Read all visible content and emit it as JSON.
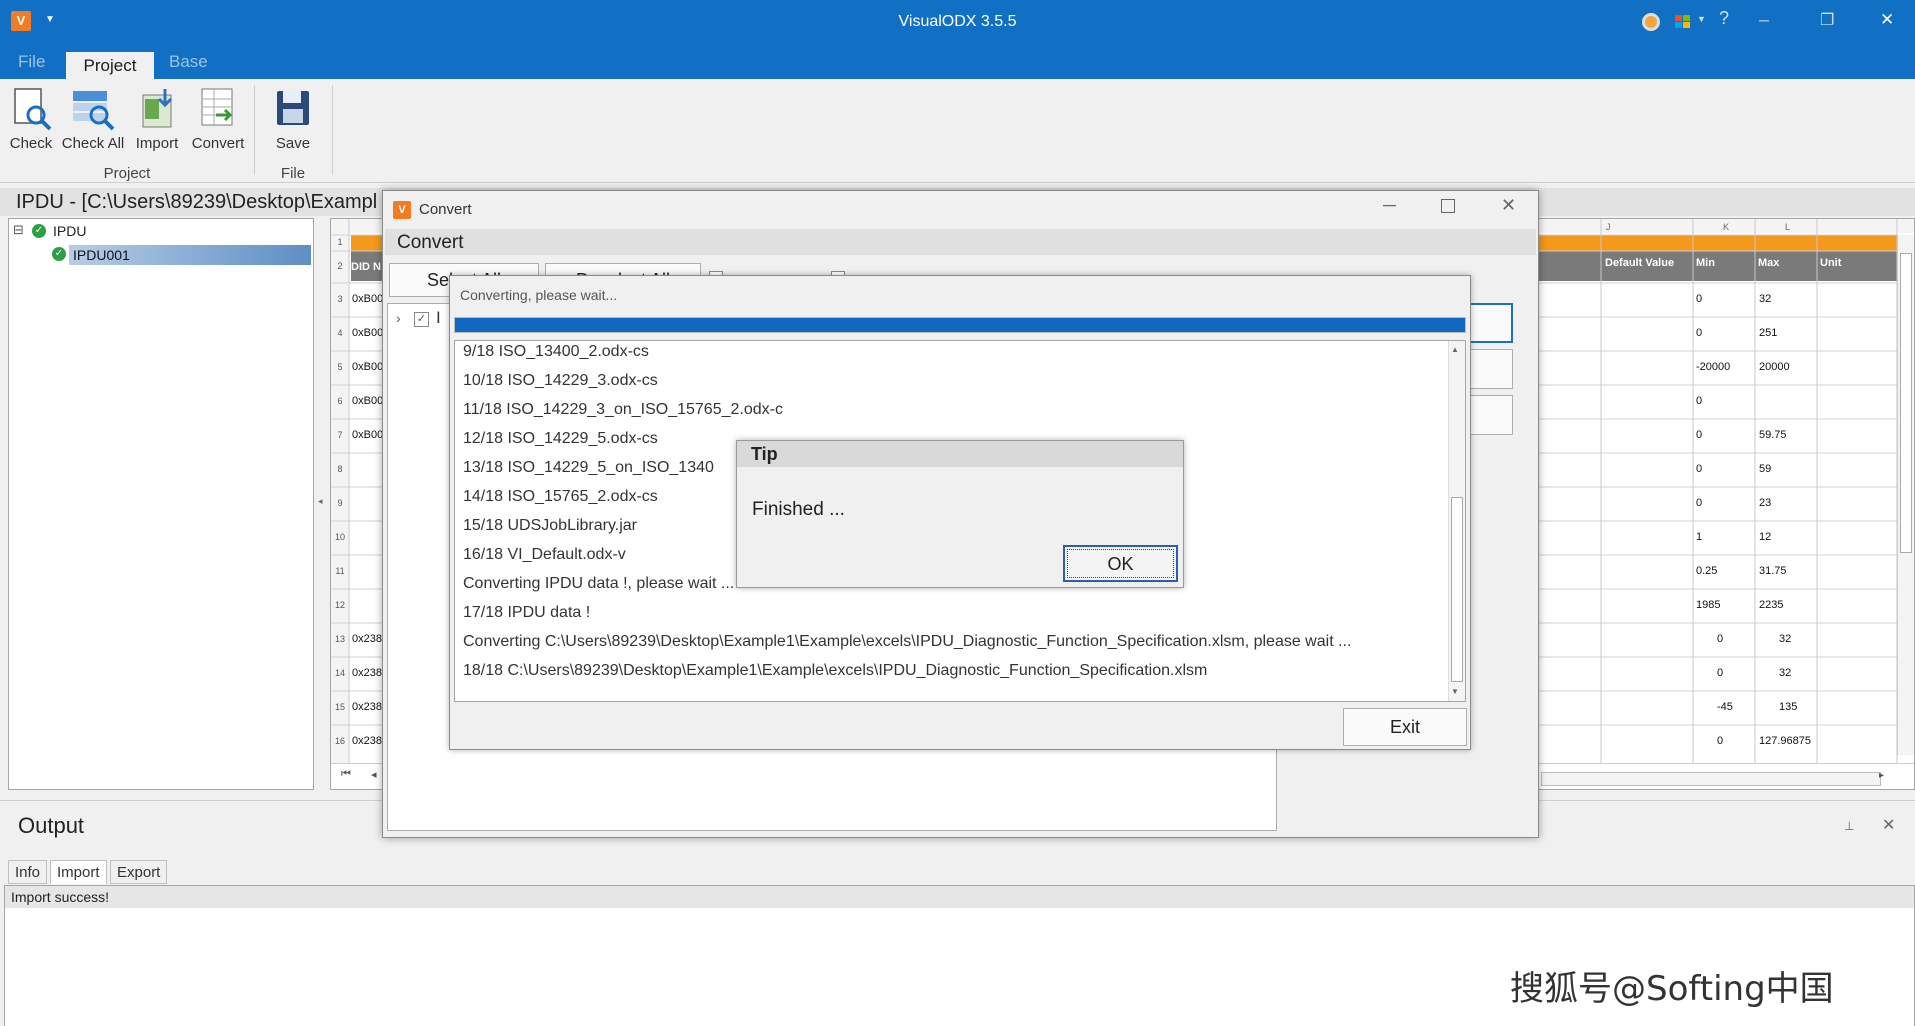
{
  "window": {
    "title": "VisualODX 3.5.5",
    "logo_text": "V",
    "controls": {
      "help": "?",
      "minimize": "─",
      "restore": "❐",
      "close": "✕"
    }
  },
  "ribbon": {
    "tabs": [
      {
        "label": "File"
      },
      {
        "label": "Project",
        "active": true
      },
      {
        "label": "Base"
      }
    ],
    "buttons": [
      {
        "label": "Check",
        "icon": "check-doc-icon"
      },
      {
        "label": "Check All",
        "icon": "check-all-icon"
      },
      {
        "label": "Import",
        "icon": "import-icon"
      },
      {
        "label": "Convert",
        "icon": "convert-icon"
      },
      {
        "label": "Save",
        "icon": "save-icon"
      }
    ],
    "groups": {
      "project": "Project",
      "file": "File"
    }
  },
  "document": {
    "title": "IPDU - [C:\\Users\\89239\\Desktop\\Exampl"
  },
  "tree": {
    "root": "IPDU",
    "child": "IPDU001",
    "expander": "⊟"
  },
  "grid": {
    "col_letters": [
      "J",
      "K",
      "L"
    ],
    "headers": {
      "did": "DID N",
      "default_value": "Default Value",
      "min": "Min",
      "max": "Max",
      "unit": "Unit"
    },
    "row_numbers": [
      "1",
      "2",
      "3",
      "4",
      "5",
      "6",
      "7",
      "8",
      "9",
      "10",
      "11",
      "12",
      "13",
      "14",
      "15",
      "16"
    ],
    "left_cells": [
      "0xB00",
      "0xB00",
      "0xB00",
      "0xB00",
      "0xB00",
      "",
      "",
      "",
      "",
      "",
      "0x238",
      "0x238",
      "0x238",
      "0x238"
    ],
    "min_values": [
      "0",
      "0",
      "-20000",
      "0",
      "0",
      "0",
      "0",
      "1",
      "0.25",
      "1985",
      "0",
      "0",
      "-45",
      "0"
    ],
    "max_values": [
      "32",
      "251",
      "20000",
      "",
      "59.75",
      "59",
      "23",
      "12",
      "31.75",
      "2235",
      "32",
      "32",
      "135",
      "127.96875"
    ]
  },
  "convert_dialog": {
    "title": "Convert",
    "heading": "Convert",
    "select_all": "Select All",
    "deselect_all": "Deselect All",
    "tree_item": "I"
  },
  "progress_dialog": {
    "title": "Converting, please wait...",
    "progress": 1.0,
    "log": [
      "9/18 ISO_13400_2.odx-cs",
      "10/18 ISO_14229_3.odx-cs",
      "11/18 ISO_14229_3_on_ISO_15765_2.odx-c",
      "12/18 ISO_14229_5.odx-cs",
      "13/18 ISO_14229_5_on_ISO_1340",
      "14/18 ISO_15765_2.odx-cs",
      "15/18 UDSJobLibrary.jar",
      "16/18 VI_Default.odx-v",
      "Converting  IPDU data !, please wait ...",
      "17/18  IPDU data !",
      "Converting C:\\Users\\89239\\Desktop\\Example1\\Example\\excels\\IPDU_Diagnostic_Function_Specification.xlsm, please wait ...",
      "18/18 C:\\Users\\89239\\Desktop\\Example1\\Example\\excels\\IPDU_Diagnostic_Function_Specification.xlsm"
    ],
    "exit_label": "Exit"
  },
  "tip_dialog": {
    "title": "Tip",
    "message": "Finished ...",
    "ok_label": "OK"
  },
  "output": {
    "title": "Output",
    "tabs": [
      {
        "label": "Info"
      },
      {
        "label": "Import",
        "active": true
      },
      {
        "label": "Export"
      }
    ],
    "message": "Import success!",
    "pin": "📌",
    "close": "✕"
  },
  "watermark": "搜狐号@Softing中国",
  "colors": {
    "titlebar": "#1170c4",
    "accent": "#f47b20",
    "grid_header": "#7a7a7a",
    "grid_orange": "#f39a1c",
    "progress": "#1068c0",
    "ok_green": "#2e9e45"
  }
}
